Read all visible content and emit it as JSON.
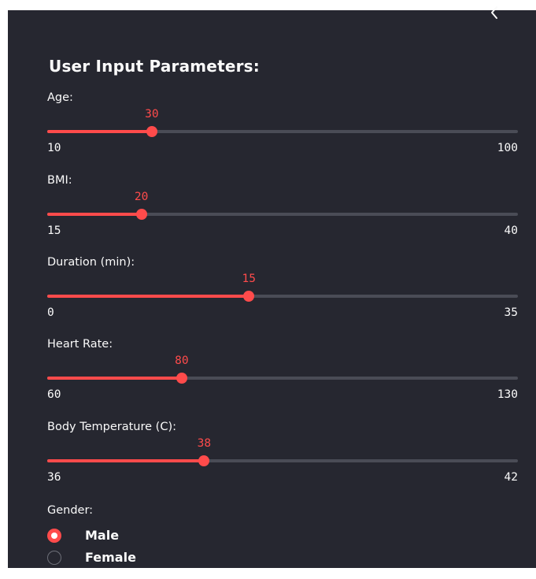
{
  "sidebar": {
    "title": "User Input Parameters:",
    "sliders": [
      {
        "label": "Age:",
        "value": "30",
        "min": "10",
        "max": "100"
      },
      {
        "label": "BMI:",
        "value": "20",
        "min": "15",
        "max": "40"
      },
      {
        "label": "Duration (min):",
        "value": "15",
        "min": "0",
        "max": "35"
      },
      {
        "label": "Heart Rate:",
        "value": "80",
        "min": "60",
        "max": "130"
      },
      {
        "label": "Body Temperature (C):",
        "value": "38",
        "min": "36",
        "max": "42"
      }
    ],
    "gender": {
      "label": "Gender:",
      "options": [
        {
          "label": "Male",
          "selected": true
        },
        {
          "label": "Female",
          "selected": false
        }
      ]
    }
  },
  "colors": {
    "background": "#262730",
    "accent": "#ff4b4b",
    "track": "#4a4c56",
    "text": "#fafafa"
  },
  "icons": {
    "collapse": "chevron-left-icon"
  }
}
